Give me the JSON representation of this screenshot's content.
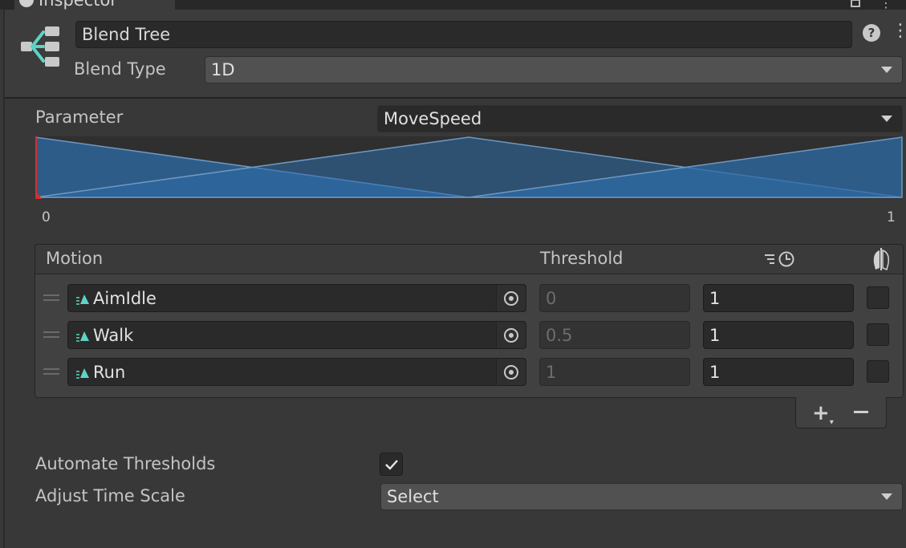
{
  "window": {
    "tab_title": "Inspector"
  },
  "header": {
    "name_value": "Blend Tree",
    "blend_type_label": "Blend Type",
    "blend_type_value": "1D"
  },
  "parameter": {
    "label": "Parameter",
    "value": "MoveSpeed"
  },
  "graph": {
    "min_label": "0",
    "max_label": "1",
    "range": [
      0,
      1
    ],
    "parameter_value": 0,
    "peaks": [
      0,
      0.5,
      1
    ],
    "fill_color": "#2d6ca7",
    "marker_color": "#d03030"
  },
  "motions": {
    "header_motion": "Motion",
    "header_threshold": "Threshold",
    "time_scale_icon": "time-scale-icon",
    "mirror_icon": "mirror-icon",
    "rows": [
      {
        "name": "AimIdle",
        "threshold": "0",
        "speed": "1",
        "mirror": false
      },
      {
        "name": "Walk",
        "threshold": "0.5",
        "speed": "1",
        "mirror": false
      },
      {
        "name": "Run",
        "threshold": "1",
        "speed": "1",
        "mirror": false
      }
    ],
    "add_icon": "plus-icon",
    "remove_icon": "minus-icon"
  },
  "options": {
    "automate_label": "Automate Thresholds",
    "automate_checked": true,
    "adjust_label": "Adjust Time Scale",
    "adjust_value": "Select"
  },
  "colors": {
    "accent_teal": "#5fd3c3",
    "panel": "#383838"
  }
}
